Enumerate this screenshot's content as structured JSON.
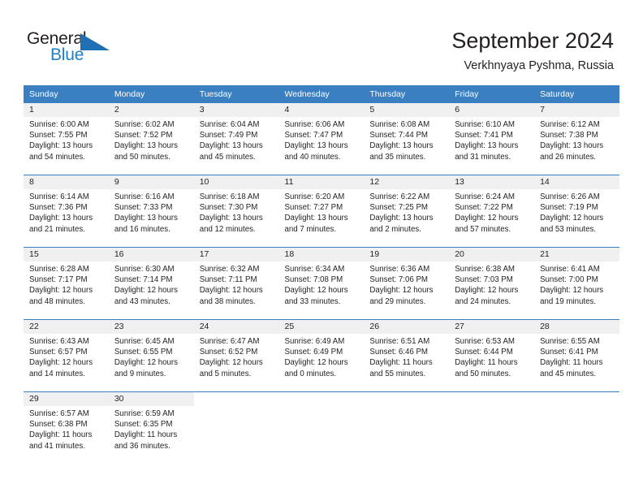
{
  "brand": {
    "name_part1": "General",
    "name_part2": "Blue",
    "triangle_icon": "blue-triangle-icon",
    "color_dark": "#231f20",
    "color_blue": "#1f7fc4"
  },
  "header": {
    "title": "September 2024",
    "subtitle": "Verkhnyaya Pyshma, Russia"
  },
  "theme": {
    "header_bg": "#3a7fc1",
    "header_text": "#ffffff",
    "daynum_bg": "#f0f0f0",
    "row_divider": "#3a7fc1",
    "body_text": "#231f20"
  },
  "calendar": {
    "weekday_headers": [
      "Sunday",
      "Monday",
      "Tuesday",
      "Wednesday",
      "Thursday",
      "Friday",
      "Saturday"
    ],
    "weeks": [
      [
        {
          "day": "1",
          "sunrise": "Sunrise: 6:00 AM",
          "sunset": "Sunset: 7:55 PM",
          "daylight_line1": "Daylight: 13 hours",
          "daylight_line2": "and 54 minutes."
        },
        {
          "day": "2",
          "sunrise": "Sunrise: 6:02 AM",
          "sunset": "Sunset: 7:52 PM",
          "daylight_line1": "Daylight: 13 hours",
          "daylight_line2": "and 50 minutes."
        },
        {
          "day": "3",
          "sunrise": "Sunrise: 6:04 AM",
          "sunset": "Sunset: 7:49 PM",
          "daylight_line1": "Daylight: 13 hours",
          "daylight_line2": "and 45 minutes."
        },
        {
          "day": "4",
          "sunrise": "Sunrise: 6:06 AM",
          "sunset": "Sunset: 7:47 PM",
          "daylight_line1": "Daylight: 13 hours",
          "daylight_line2": "and 40 minutes."
        },
        {
          "day": "5",
          "sunrise": "Sunrise: 6:08 AM",
          "sunset": "Sunset: 7:44 PM",
          "daylight_line1": "Daylight: 13 hours",
          "daylight_line2": "and 35 minutes."
        },
        {
          "day": "6",
          "sunrise": "Sunrise: 6:10 AM",
          "sunset": "Sunset: 7:41 PM",
          "daylight_line1": "Daylight: 13 hours",
          "daylight_line2": "and 31 minutes."
        },
        {
          "day": "7",
          "sunrise": "Sunrise: 6:12 AM",
          "sunset": "Sunset: 7:38 PM",
          "daylight_line1": "Daylight: 13 hours",
          "daylight_line2": "and 26 minutes."
        }
      ],
      [
        {
          "day": "8",
          "sunrise": "Sunrise: 6:14 AM",
          "sunset": "Sunset: 7:36 PM",
          "daylight_line1": "Daylight: 13 hours",
          "daylight_line2": "and 21 minutes."
        },
        {
          "day": "9",
          "sunrise": "Sunrise: 6:16 AM",
          "sunset": "Sunset: 7:33 PM",
          "daylight_line1": "Daylight: 13 hours",
          "daylight_line2": "and 16 minutes."
        },
        {
          "day": "10",
          "sunrise": "Sunrise: 6:18 AM",
          "sunset": "Sunset: 7:30 PM",
          "daylight_line1": "Daylight: 13 hours",
          "daylight_line2": "and 12 minutes."
        },
        {
          "day": "11",
          "sunrise": "Sunrise: 6:20 AM",
          "sunset": "Sunset: 7:27 PM",
          "daylight_line1": "Daylight: 13 hours",
          "daylight_line2": "and 7 minutes."
        },
        {
          "day": "12",
          "sunrise": "Sunrise: 6:22 AM",
          "sunset": "Sunset: 7:25 PM",
          "daylight_line1": "Daylight: 13 hours",
          "daylight_line2": "and 2 minutes."
        },
        {
          "day": "13",
          "sunrise": "Sunrise: 6:24 AM",
          "sunset": "Sunset: 7:22 PM",
          "daylight_line1": "Daylight: 12 hours",
          "daylight_line2": "and 57 minutes."
        },
        {
          "day": "14",
          "sunrise": "Sunrise: 6:26 AM",
          "sunset": "Sunset: 7:19 PM",
          "daylight_line1": "Daylight: 12 hours",
          "daylight_line2": "and 53 minutes."
        }
      ],
      [
        {
          "day": "15",
          "sunrise": "Sunrise: 6:28 AM",
          "sunset": "Sunset: 7:17 PM",
          "daylight_line1": "Daylight: 12 hours",
          "daylight_line2": "and 48 minutes."
        },
        {
          "day": "16",
          "sunrise": "Sunrise: 6:30 AM",
          "sunset": "Sunset: 7:14 PM",
          "daylight_line1": "Daylight: 12 hours",
          "daylight_line2": "and 43 minutes."
        },
        {
          "day": "17",
          "sunrise": "Sunrise: 6:32 AM",
          "sunset": "Sunset: 7:11 PM",
          "daylight_line1": "Daylight: 12 hours",
          "daylight_line2": "and 38 minutes."
        },
        {
          "day": "18",
          "sunrise": "Sunrise: 6:34 AM",
          "sunset": "Sunset: 7:08 PM",
          "daylight_line1": "Daylight: 12 hours",
          "daylight_line2": "and 33 minutes."
        },
        {
          "day": "19",
          "sunrise": "Sunrise: 6:36 AM",
          "sunset": "Sunset: 7:06 PM",
          "daylight_line1": "Daylight: 12 hours",
          "daylight_line2": "and 29 minutes."
        },
        {
          "day": "20",
          "sunrise": "Sunrise: 6:38 AM",
          "sunset": "Sunset: 7:03 PM",
          "daylight_line1": "Daylight: 12 hours",
          "daylight_line2": "and 24 minutes."
        },
        {
          "day": "21",
          "sunrise": "Sunrise: 6:41 AM",
          "sunset": "Sunset: 7:00 PM",
          "daylight_line1": "Daylight: 12 hours",
          "daylight_line2": "and 19 minutes."
        }
      ],
      [
        {
          "day": "22",
          "sunrise": "Sunrise: 6:43 AM",
          "sunset": "Sunset: 6:57 PM",
          "daylight_line1": "Daylight: 12 hours",
          "daylight_line2": "and 14 minutes."
        },
        {
          "day": "23",
          "sunrise": "Sunrise: 6:45 AM",
          "sunset": "Sunset: 6:55 PM",
          "daylight_line1": "Daylight: 12 hours",
          "daylight_line2": "and 9 minutes."
        },
        {
          "day": "24",
          "sunrise": "Sunrise: 6:47 AM",
          "sunset": "Sunset: 6:52 PM",
          "daylight_line1": "Daylight: 12 hours",
          "daylight_line2": "and 5 minutes."
        },
        {
          "day": "25",
          "sunrise": "Sunrise: 6:49 AM",
          "sunset": "Sunset: 6:49 PM",
          "daylight_line1": "Daylight: 12 hours",
          "daylight_line2": "and 0 minutes."
        },
        {
          "day": "26",
          "sunrise": "Sunrise: 6:51 AM",
          "sunset": "Sunset: 6:46 PM",
          "daylight_line1": "Daylight: 11 hours",
          "daylight_line2": "and 55 minutes."
        },
        {
          "day": "27",
          "sunrise": "Sunrise: 6:53 AM",
          "sunset": "Sunset: 6:44 PM",
          "daylight_line1": "Daylight: 11 hours",
          "daylight_line2": "and 50 minutes."
        },
        {
          "day": "28",
          "sunrise": "Sunrise: 6:55 AM",
          "sunset": "Sunset: 6:41 PM",
          "daylight_line1": "Daylight: 11 hours",
          "daylight_line2": "and 45 minutes."
        }
      ],
      [
        {
          "day": "29",
          "sunrise": "Sunrise: 6:57 AM",
          "sunset": "Sunset: 6:38 PM",
          "daylight_line1": "Daylight: 11 hours",
          "daylight_line2": "and 41 minutes."
        },
        {
          "day": "30",
          "sunrise": "Sunrise: 6:59 AM",
          "sunset": "Sunset: 6:35 PM",
          "daylight_line1": "Daylight: 11 hours",
          "daylight_line2": "and 36 minutes."
        },
        {
          "day": "",
          "sunrise": "",
          "sunset": "",
          "daylight_line1": "",
          "daylight_line2": ""
        },
        {
          "day": "",
          "sunrise": "",
          "sunset": "",
          "daylight_line1": "",
          "daylight_line2": ""
        },
        {
          "day": "",
          "sunrise": "",
          "sunset": "",
          "daylight_line1": "",
          "daylight_line2": ""
        },
        {
          "day": "",
          "sunrise": "",
          "sunset": "",
          "daylight_line1": "",
          "daylight_line2": ""
        },
        {
          "day": "",
          "sunrise": "",
          "sunset": "",
          "daylight_line1": "",
          "daylight_line2": ""
        }
      ]
    ]
  }
}
